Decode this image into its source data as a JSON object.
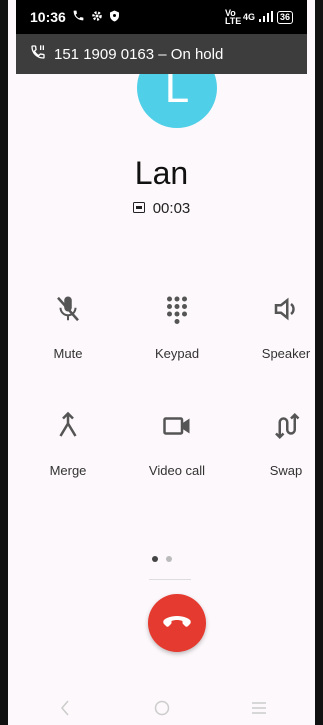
{
  "status_bar": {
    "time": "10:36",
    "network": "Vo LTE",
    "signal": "4G",
    "battery": "36"
  },
  "hold_banner": {
    "icon": "phone-hold-icon",
    "text": "151 1909 0163 – On hold"
  },
  "caller": {
    "avatar_letter": "L",
    "avatar_color": "#4fd0e8",
    "name": "Lan",
    "timer_icon": "hd-icon",
    "duration": "00:03"
  },
  "controls": [
    {
      "label": "Mute",
      "icon": "mic-off-icon"
    },
    {
      "label": "Keypad",
      "icon": "keypad-icon"
    },
    {
      "label": "Speaker",
      "icon": "speaker-icon"
    },
    {
      "label": "Merge",
      "icon": "merge-icon"
    },
    {
      "label": "Video call",
      "icon": "videocam-icon"
    },
    {
      "label": "Swap",
      "icon": "swap-icon"
    }
  ],
  "pager": {
    "pages": 2,
    "active": 0
  },
  "end_call": {
    "icon": "end-call-icon",
    "color": "#e53a2f"
  },
  "nav_bar": {
    "back": "back-icon",
    "home": "home-icon",
    "recents": "recents-icon"
  }
}
